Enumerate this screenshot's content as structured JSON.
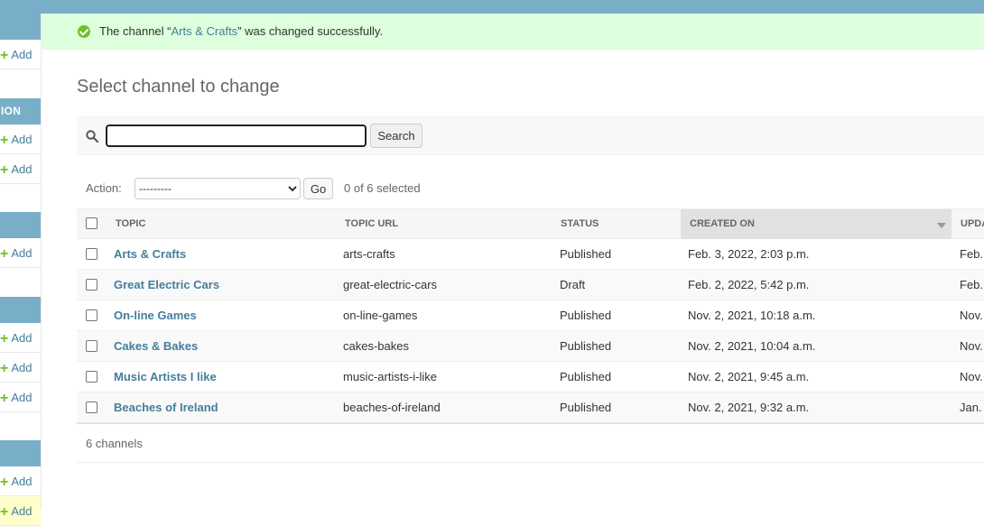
{
  "sidebar": {
    "headers": [
      "",
      "ION",
      "",
      "",
      ""
    ],
    "add_label": "Add"
  },
  "message": {
    "prefix": "The channel “",
    "link": "Arts & Crafts",
    "suffix": "” was changed successfully."
  },
  "page_title": "Select channel to change",
  "search": {
    "value": "",
    "button_label": "Search"
  },
  "actions": {
    "label": "Action:",
    "selected_option": "---------",
    "go_label": "Go",
    "selection_count": "0 of 6 selected"
  },
  "table": {
    "columns": [
      "Topic",
      "Topic URL",
      "Status",
      "Created on",
      "Upda"
    ],
    "rows": [
      {
        "topic": "Arts & Crafts",
        "url": "arts-crafts",
        "status": "Published",
        "created": "Feb. 3, 2022, 2:03 p.m.",
        "updated": "Feb."
      },
      {
        "topic": "Great Electric Cars",
        "url": "great-electric-cars",
        "status": "Draft",
        "created": "Feb. 2, 2022, 5:42 p.m.",
        "updated": "Feb."
      },
      {
        "topic": "On-line Games",
        "url": "on-line-games",
        "status": "Published",
        "created": "Nov. 2, 2021, 10:18 a.m.",
        "updated": "Nov."
      },
      {
        "topic": "Cakes & Bakes",
        "url": "cakes-bakes",
        "status": "Published",
        "created": "Nov. 2, 2021, 10:04 a.m.",
        "updated": "Nov."
      },
      {
        "topic": "Music Artists I like",
        "url": "music-artists-i-like",
        "status": "Published",
        "created": "Nov. 2, 2021, 9:45 a.m.",
        "updated": "Nov."
      },
      {
        "topic": "Beaches of Ireland",
        "url": "beaches-of-ireland",
        "status": "Published",
        "created": "Nov. 2, 2021, 9:32 a.m.",
        "updated": "Jan."
      }
    ],
    "footer": "6 channels"
  },
  "colors": {
    "header_blue": "#79aec8",
    "link_blue": "#447e9b",
    "success_bg": "#ddffdd",
    "add_green": "#70bf2b"
  }
}
